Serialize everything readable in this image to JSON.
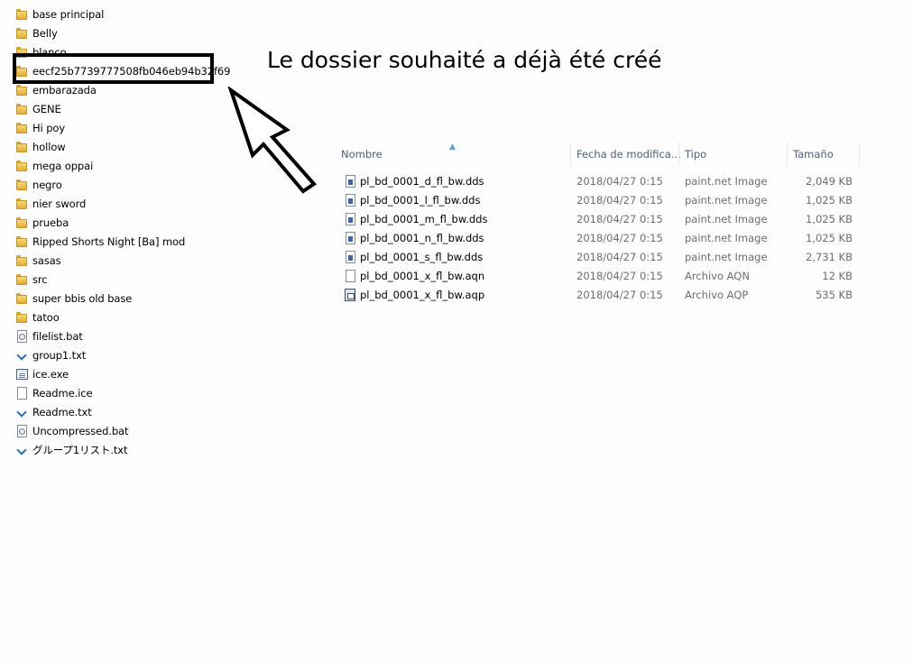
{
  "left_items": [
    {
      "label": "base principal",
      "icon": "folder-icon"
    },
    {
      "label": "Belly",
      "icon": "folder-icon"
    },
    {
      "label": "blanco",
      "icon": "folder-icon"
    },
    {
      "label": "eecf25b7739777508fb046eb94b32f69",
      "icon": "folder-icon"
    },
    {
      "label": "embarazada",
      "icon": "folder-icon"
    },
    {
      "label": "GENE",
      "icon": "folder-icon"
    },
    {
      "label": "Hi poy",
      "icon": "folder-icon"
    },
    {
      "label": "hollow",
      "icon": "folder-icon"
    },
    {
      "label": "mega oppai",
      "icon": "folder-icon"
    },
    {
      "label": "negro",
      "icon": "folder-icon"
    },
    {
      "label": "nier sword",
      "icon": "folder-icon"
    },
    {
      "label": "prueba",
      "icon": "folder-icon"
    },
    {
      "label": "Ripped Shorts Night [Ba] mod",
      "icon": "folder-icon"
    },
    {
      "label": "sasas",
      "icon": "folder-icon"
    },
    {
      "label": "src",
      "icon": "folder-icon"
    },
    {
      "label": "super bbis old base",
      "icon": "folder-icon"
    },
    {
      "label": "tatoo",
      "icon": "folder-icon"
    },
    {
      "label": "filelist.bat",
      "icon": "bat-file-icon"
    },
    {
      "label": "group1.txt",
      "icon": "vscode-file-icon"
    },
    {
      "label": "ice.exe",
      "icon": "exe-file-icon"
    },
    {
      "label": "Readme.ice",
      "icon": "blank-file-icon"
    },
    {
      "label": "Readme.txt",
      "icon": "vscode-file-icon"
    },
    {
      "label": "Uncompressed.bat",
      "icon": "bat-file-icon"
    },
    {
      "label": "グループ1リスト.txt",
      "icon": "vscode-file-icon"
    }
  ],
  "annotation": {
    "text": "Le dossier souhaité a déjà été créé"
  },
  "file_list": {
    "columns": {
      "name": "Nombre",
      "date": "Fecha de modifica...",
      "type": "Tipo",
      "size": "Tamaño"
    },
    "rows": [
      {
        "name": "pl_bd_0001_d_fl_bw.dds",
        "date": "2018/04/27 0:15",
        "type": "paint.net Image",
        "size": "2,049 KB",
        "icon": "image-file-icon"
      },
      {
        "name": "pl_bd_0001_l_fl_bw.dds",
        "date": "2018/04/27 0:15",
        "type": "paint.net Image",
        "size": "1,025 KB",
        "icon": "image-file-icon"
      },
      {
        "name": "pl_bd_0001_m_fl_bw.dds",
        "date": "2018/04/27 0:15",
        "type": "paint.net Image",
        "size": "1,025 KB",
        "icon": "image-file-icon"
      },
      {
        "name": "pl_bd_0001_n_fl_bw.dds",
        "date": "2018/04/27 0:15",
        "type": "paint.net Image",
        "size": "1,025 KB",
        "icon": "image-file-icon"
      },
      {
        "name": "pl_bd_0001_s_fl_bw.dds",
        "date": "2018/04/27 0:15",
        "type": "paint.net Image",
        "size": "2,731 KB",
        "icon": "image-file-icon"
      },
      {
        "name": "pl_bd_0001_x_fl_bw.aqn",
        "date": "2018/04/27 0:15",
        "type": "Archivo AQN",
        "size": "12 KB",
        "icon": "blank-file-icon"
      },
      {
        "name": "pl_bd_0001_x_fl_bw.aqp",
        "date": "2018/04/27 0:15",
        "type": "Archivo AQP",
        "size": "535 KB",
        "icon": "aqp-file-icon"
      }
    ]
  }
}
